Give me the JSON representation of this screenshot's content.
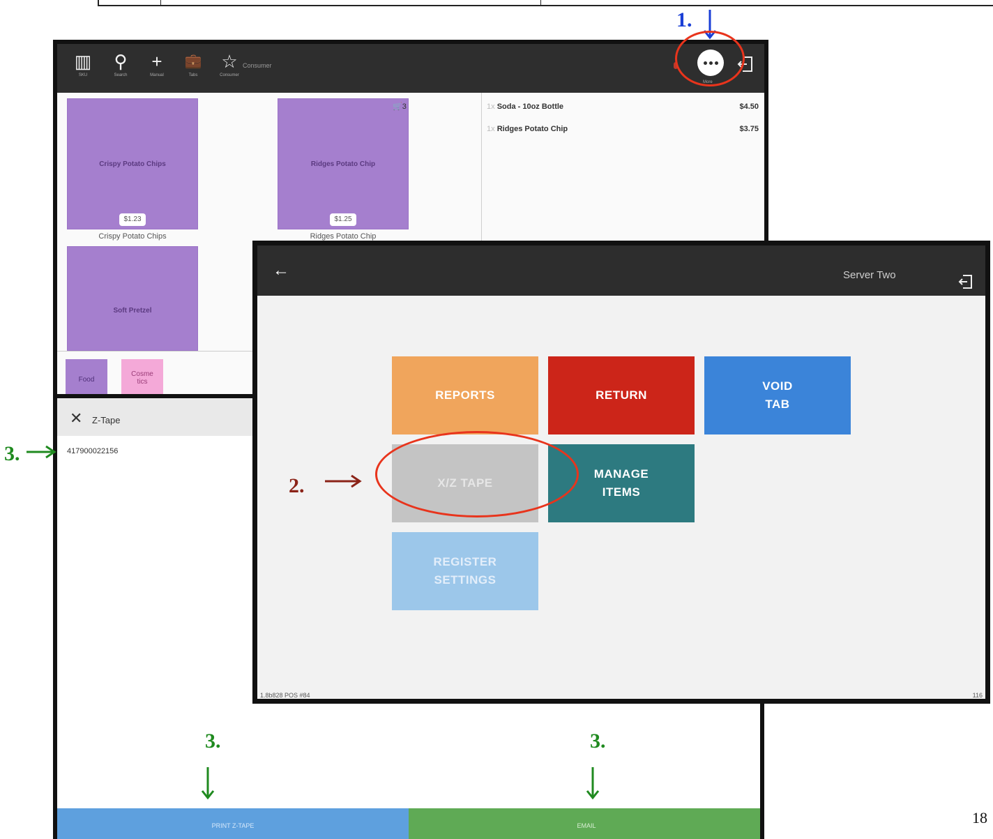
{
  "doc": {
    "page_number": "18"
  },
  "pos_screen": {
    "toolbar": [
      {
        "icon": "barcode-icon",
        "glyph": "▥",
        "label": "SKU"
      },
      {
        "icon": "search-icon",
        "glyph": "⚲",
        "label": "Search"
      },
      {
        "icon": "plus-icon",
        "glyph": "+",
        "label": "Manual"
      },
      {
        "icon": "briefcase-icon",
        "glyph": "💼",
        "label": "Tabs"
      },
      {
        "icon": "star-icon",
        "glyph": "☆",
        "label": "Consumer"
      }
    ],
    "consumer_label": "Consumer",
    "more_label": "More",
    "products": [
      {
        "tile_name": "Crispy Potato Chips",
        "price": "$1.23",
        "label": "Crispy Potato Chips"
      },
      {
        "tile_name": "Ridges Potato Chip",
        "price": "$1.25",
        "label": "Ridges Potato Chip",
        "cart_count": "3"
      },
      {
        "tile_name": "Soft Pretzel"
      }
    ],
    "order": [
      {
        "qty": "1x",
        "name": "Soda - 10oz Bottle",
        "price": "$4.50"
      },
      {
        "qty": "1x",
        "name": "Ridges Potato Chip",
        "price": "$3.75"
      }
    ],
    "categories": [
      {
        "label": "Food",
        "color": "#a57fce",
        "text_color": "#4f2f78"
      },
      {
        "label": "Cosme tics",
        "color": "#f4a9d8",
        "text_color": "#9a3c78"
      }
    ]
  },
  "manager_screen": {
    "user": "Server Two",
    "tiles": [
      {
        "lines": [
          "REPORTS"
        ],
        "color": "#f0a55c"
      },
      {
        "lines": [
          "RETURN"
        ],
        "color": "#cc2519"
      },
      {
        "lines": [
          "VOID",
          "TAB"
        ],
        "color": "#3b84d9"
      },
      {
        "lines": [
          "X/Z TAPE"
        ],
        "color": "#c4c4c4"
      },
      {
        "lines": [
          "MANAGE",
          "ITEMS"
        ],
        "color": "#2d7a80"
      },
      {
        "lines": [
          "REGISTER",
          "SETTINGS"
        ],
        "color": "#9cc7ea"
      }
    ],
    "footer_left": "1.8b828 POS #84",
    "footer_right": "116"
  },
  "ztape_screen": {
    "title": "Z-Tape",
    "number": "417900022156",
    "left_button": "PRINT Z-TAPE",
    "right_button": "EMAIL"
  },
  "annotations": {
    "step1": "1.",
    "step2": "2.",
    "step3": "3.",
    "colors": {
      "step1": "#1a3fd6",
      "step2": "#8b2318",
      "step3": "#1f8a1f",
      "highlight": "#e8341c"
    }
  }
}
